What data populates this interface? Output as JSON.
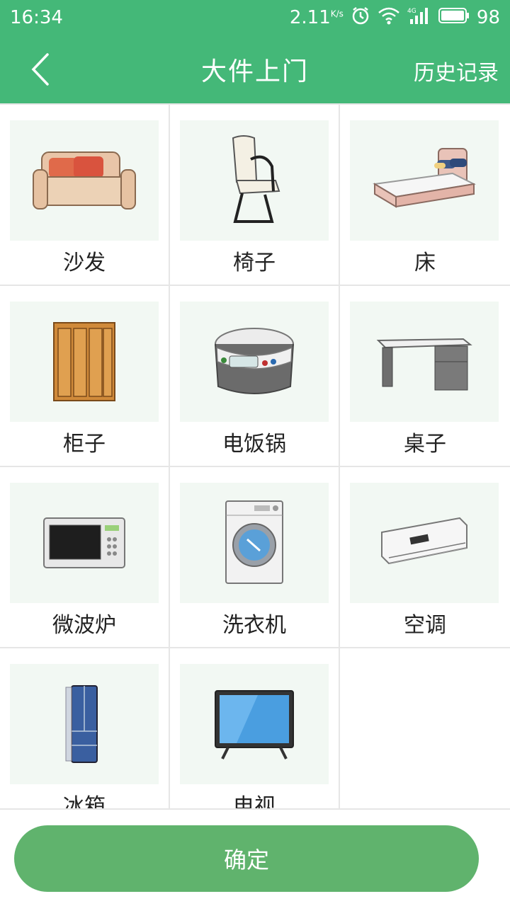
{
  "status_bar": {
    "time": "16:34",
    "net_speed": "2.11",
    "net_unit": "K/s",
    "battery": "98"
  },
  "nav": {
    "title": "大件上门",
    "history": "历史记录"
  },
  "items": [
    {
      "label": "沙发",
      "icon": "sofa-icon"
    },
    {
      "label": "椅子",
      "icon": "chair-icon"
    },
    {
      "label": "床",
      "icon": "bed-icon"
    },
    {
      "label": "柜子",
      "icon": "wardrobe-icon"
    },
    {
      "label": "电饭锅",
      "icon": "rice-cooker-icon"
    },
    {
      "label": "桌子",
      "icon": "desk-icon"
    },
    {
      "label": "微波炉",
      "icon": "microwave-icon"
    },
    {
      "label": "洗衣机",
      "icon": "washing-machine-icon"
    },
    {
      "label": "空调",
      "icon": "air-conditioner-icon"
    },
    {
      "label": "冰箱",
      "icon": "fridge-icon"
    },
    {
      "label": "电视",
      "icon": "tv-icon"
    }
  ],
  "confirm_label": "确定",
  "colors": {
    "header": "#44b878",
    "button": "#60b36d",
    "thumb_bg": "#f2f8f3"
  }
}
